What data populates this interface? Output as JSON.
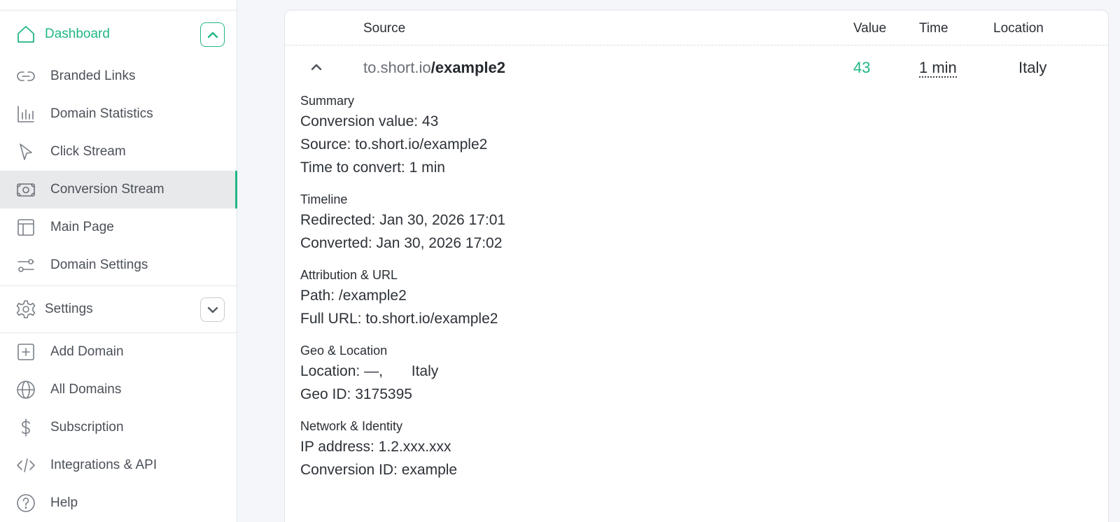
{
  "colors": {
    "accent": "#21b784",
    "active_bg": "#e8e9eb",
    "border": "#e2e5ea"
  },
  "sidebar": {
    "dashboard": {
      "label": "Dashboard",
      "icon": "home-icon",
      "toggle_icon": "chevron-up-icon"
    },
    "dashboard_items": [
      {
        "label": "Branded Links",
        "icon": "link-icon"
      },
      {
        "label": "Domain Statistics",
        "icon": "bar-chart-icon"
      },
      {
        "label": "Click Stream",
        "icon": "cursor-icon"
      },
      {
        "label": "Conversion Stream",
        "icon": "money-icon",
        "active": true
      },
      {
        "label": "Main Page",
        "icon": "layout-icon"
      },
      {
        "label": "Domain Settings",
        "icon": "sliders-icon"
      }
    ],
    "settings": {
      "label": "Settings",
      "icon": "gear-icon",
      "toggle_icon": "chevron-down-icon"
    },
    "other_items": [
      {
        "label": "Add Domain",
        "icon": "plus-square-icon"
      },
      {
        "label": "All Domains",
        "icon": "globe-icon"
      },
      {
        "label": "Subscription",
        "icon": "dollar-icon"
      },
      {
        "label": "Integrations & API",
        "icon": "code-icon"
      },
      {
        "label": "Help",
        "icon": "help-circle-icon"
      }
    ]
  },
  "table": {
    "columns": {
      "source": "Source",
      "value": "Value",
      "time": "Time",
      "location": "Location"
    },
    "row": {
      "source_domain": "to.short.io",
      "source_path": "/example2",
      "value": "43",
      "time": "1 min",
      "location": "Italy"
    }
  },
  "details": [
    {
      "title": "Summary",
      "lines": [
        "Conversion value: 43",
        "Source: to.short.io/example2",
        "Time to convert: 1 min"
      ]
    },
    {
      "title": "Timeline",
      "lines": [
        "Redirected: Jan 30, 2026 17:01",
        "Converted: Jan 30, 2026 17:02"
      ]
    },
    {
      "title": "Attribution & URL",
      "lines": [
        "Path: /example2",
        "Full URL: to.short.io/example2"
      ]
    },
    {
      "title": "Geo & Location",
      "lines": [
        "Location: —,       Italy",
        "Geo ID: 3175395"
      ]
    },
    {
      "title": "Network & Identity",
      "lines": [
        "IP address: 1.2.xxx.xxx",
        "Conversion ID: example"
      ]
    }
  ]
}
